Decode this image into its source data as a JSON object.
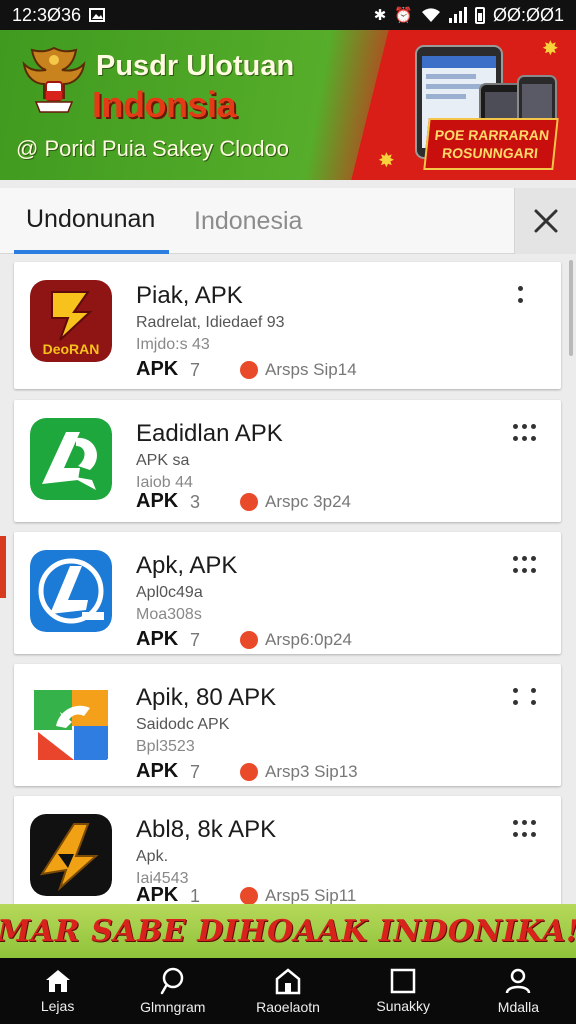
{
  "status_bar": {
    "time": "12:3Ø36",
    "right_time": "ØØ:ØØ1"
  },
  "banner": {
    "title_line1": "Pusdr Ulotuan",
    "title_line2": "Indonsia",
    "subtitle": "@ Porid Puia Sakey Clodoo",
    "promo_line1": "POE RARRARAN",
    "promo_line2": "ROSUNNGARI",
    "colors": {
      "green": "#4ca424",
      "red": "#d81e16"
    }
  },
  "tabs": [
    {
      "label": "Undonunan",
      "active": true
    },
    {
      "label": "Indonesia",
      "active": false
    }
  ],
  "apps": [
    {
      "name": "Piak, APK",
      "meta1": "Radrelat, Idiedaef 93",
      "meta2": "Imjdo:s 43",
      "apk_label": "APK",
      "apk_num": "7",
      "rating": "Arsps Sip14",
      "icon": "yellow-bolt-icon"
    },
    {
      "name": "Eadidlan APK",
      "meta1": "APK sa",
      "meta2": "Iaiob 44",
      "apk_label": "APK",
      "apk_num": "3",
      "rating": "Arspc 3p24",
      "icon": "green-a-icon"
    },
    {
      "name": "Apk, APK",
      "meta1": "Apl0c49a",
      "meta2": "Moa308s",
      "apk_label": "APK",
      "apk_num": "7",
      "rating": "Arsp6:0p24",
      "icon": "blue-a-icon"
    },
    {
      "name": "Apik, 80 APK",
      "meta1": "Saidodc APK",
      "meta2": "Bpl3523",
      "apk_label": "APK",
      "apk_num": "7",
      "rating": "Arsp3 Sip13",
      "icon": "google-play-icon"
    },
    {
      "name": "Abl8, 8k APK",
      "meta1": "Apk.",
      "meta2": "Iai4543",
      "apk_label": "APK",
      "apk_num": "1",
      "rating": "Arsp5 Sip11",
      "icon": "gold-a-icon"
    }
  ],
  "promo_bar": {
    "text": "IMAR SABE DIHOAAK INDONIKA!!"
  },
  "bottom_nav": [
    {
      "label": "Lejas",
      "icon": "home-icon"
    },
    {
      "label": "Glmngram",
      "icon": "search-icon"
    },
    {
      "label": "Raoelaotn",
      "icon": "store-icon"
    },
    {
      "label": "Sunakky",
      "icon": "square-icon"
    },
    {
      "label": "Mdalla",
      "icon": "person-icon"
    }
  ]
}
